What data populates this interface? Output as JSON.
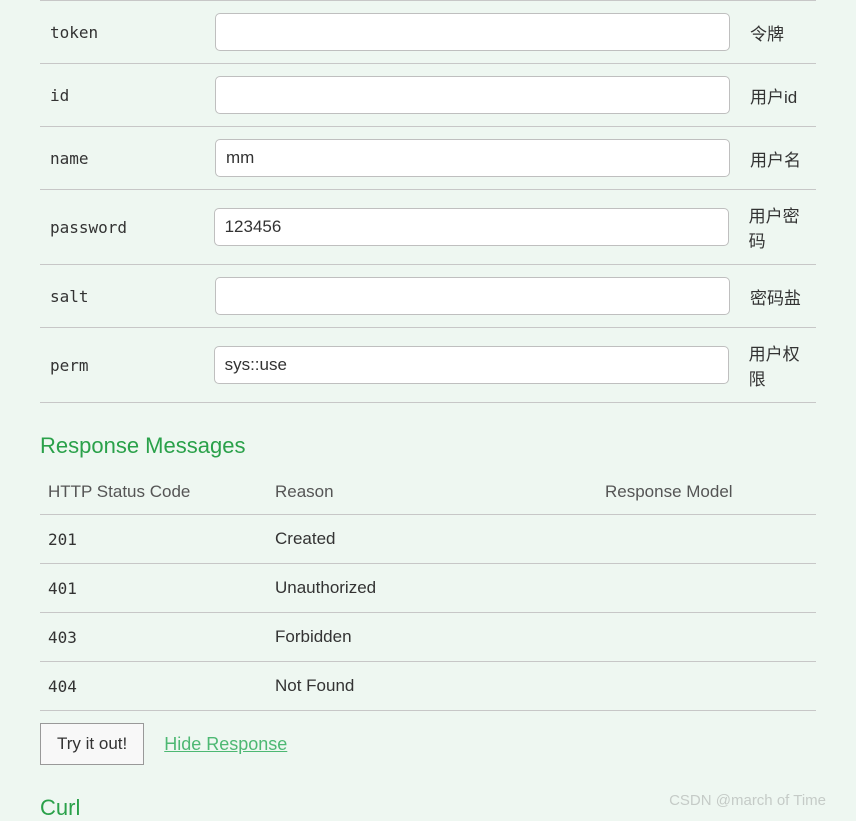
{
  "params": [
    {
      "name": "token",
      "value": "",
      "desc": "令牌"
    },
    {
      "name": "id",
      "value": "",
      "desc": "用户id"
    },
    {
      "name": "name",
      "value": "mm",
      "desc": "用户名"
    },
    {
      "name": "password",
      "value": "123456",
      "desc": "用户密码"
    },
    {
      "name": "salt",
      "value": "",
      "desc": "密码盐"
    },
    {
      "name": "perm",
      "value": "sys::use",
      "desc": "用户权限"
    }
  ],
  "response_section_title": "Response Messages",
  "response_headers": {
    "code": "HTTP Status Code",
    "reason": "Reason",
    "model": "Response Model"
  },
  "responses": [
    {
      "code": "201",
      "reason": "Created"
    },
    {
      "code": "401",
      "reason": "Unauthorized"
    },
    {
      "code": "403",
      "reason": "Forbidden"
    },
    {
      "code": "404",
      "reason": "Not Found"
    }
  ],
  "actions": {
    "try": "Try it out!",
    "hide": "Hide Response"
  },
  "curl_title": "Curl",
  "watermark": "CSDN @march of Time"
}
